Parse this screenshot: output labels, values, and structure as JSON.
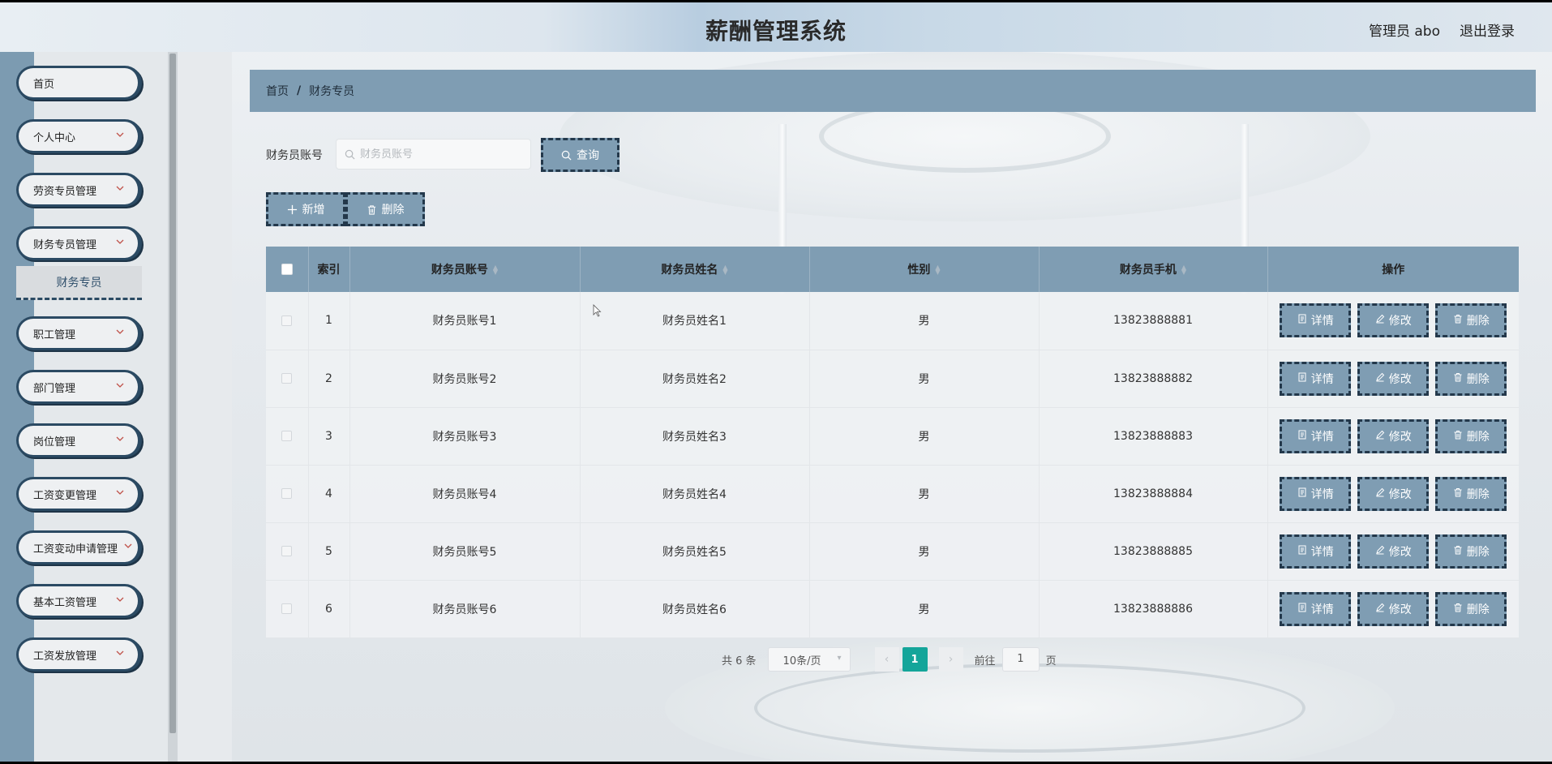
{
  "app": {
    "title": "薪酬管理系统",
    "user": "管理员 abo",
    "logout": "退出登录"
  },
  "sidebar": {
    "items": [
      {
        "label": "首页",
        "has_arrow": false
      },
      {
        "label": "个人中心",
        "has_arrow": true
      },
      {
        "label": "劳资专员管理",
        "has_arrow": true
      },
      {
        "label": "财务专员管理",
        "has_arrow": true
      },
      {
        "label": "职工管理",
        "has_arrow": true
      },
      {
        "label": "部门管理",
        "has_arrow": true
      },
      {
        "label": "岗位管理",
        "has_arrow": true
      },
      {
        "label": "工资变更管理",
        "has_arrow": true
      },
      {
        "label": "工资变动申请管理",
        "has_arrow": true
      },
      {
        "label": "基本工资管理",
        "has_arrow": true
      },
      {
        "label": "工资发放管理",
        "has_arrow": true
      }
    ],
    "sub_item": "财务专员"
  },
  "breadcrumb": {
    "home": "首页",
    "separator": "/",
    "current": "财务专员"
  },
  "search": {
    "label": "财务员账号",
    "placeholder": "财务员账号",
    "button": "查询"
  },
  "actions": {
    "add": "新增",
    "delete": "删除"
  },
  "table": {
    "columns": [
      "索引",
      "财务员账号",
      "财务员姓名",
      "性别",
      "财务员手机",
      "操作"
    ],
    "rows": [
      {
        "index": "1",
        "account": "财务员账号1",
        "name": "财务员姓名1",
        "gender": "男",
        "phone": "13823888881"
      },
      {
        "index": "2",
        "account": "财务员账号2",
        "name": "财务员姓名2",
        "gender": "男",
        "phone": "13823888882"
      },
      {
        "index": "3",
        "account": "财务员账号3",
        "name": "财务员姓名3",
        "gender": "男",
        "phone": "13823888883"
      },
      {
        "index": "4",
        "account": "财务员账号4",
        "name": "财务员姓名4",
        "gender": "男",
        "phone": "13823888884"
      },
      {
        "index": "5",
        "account": "财务员账号5",
        "name": "财务员姓名5",
        "gender": "男",
        "phone": "13823888885"
      },
      {
        "index": "6",
        "account": "财务员账号6",
        "name": "财务员姓名6",
        "gender": "男",
        "phone": "13823888886"
      }
    ],
    "row_actions": {
      "detail": "详情",
      "edit": "修改",
      "delete": "删除"
    }
  },
  "pagination": {
    "total": "共 6 条",
    "page_size": "10条/页",
    "current_page": "1",
    "goto_label": "前往",
    "goto_value": "1",
    "page_suffix": "页"
  },
  "colors": {
    "accent": "#7f9db3",
    "dark_border": "#23384b",
    "active_page": "#14a59a"
  }
}
